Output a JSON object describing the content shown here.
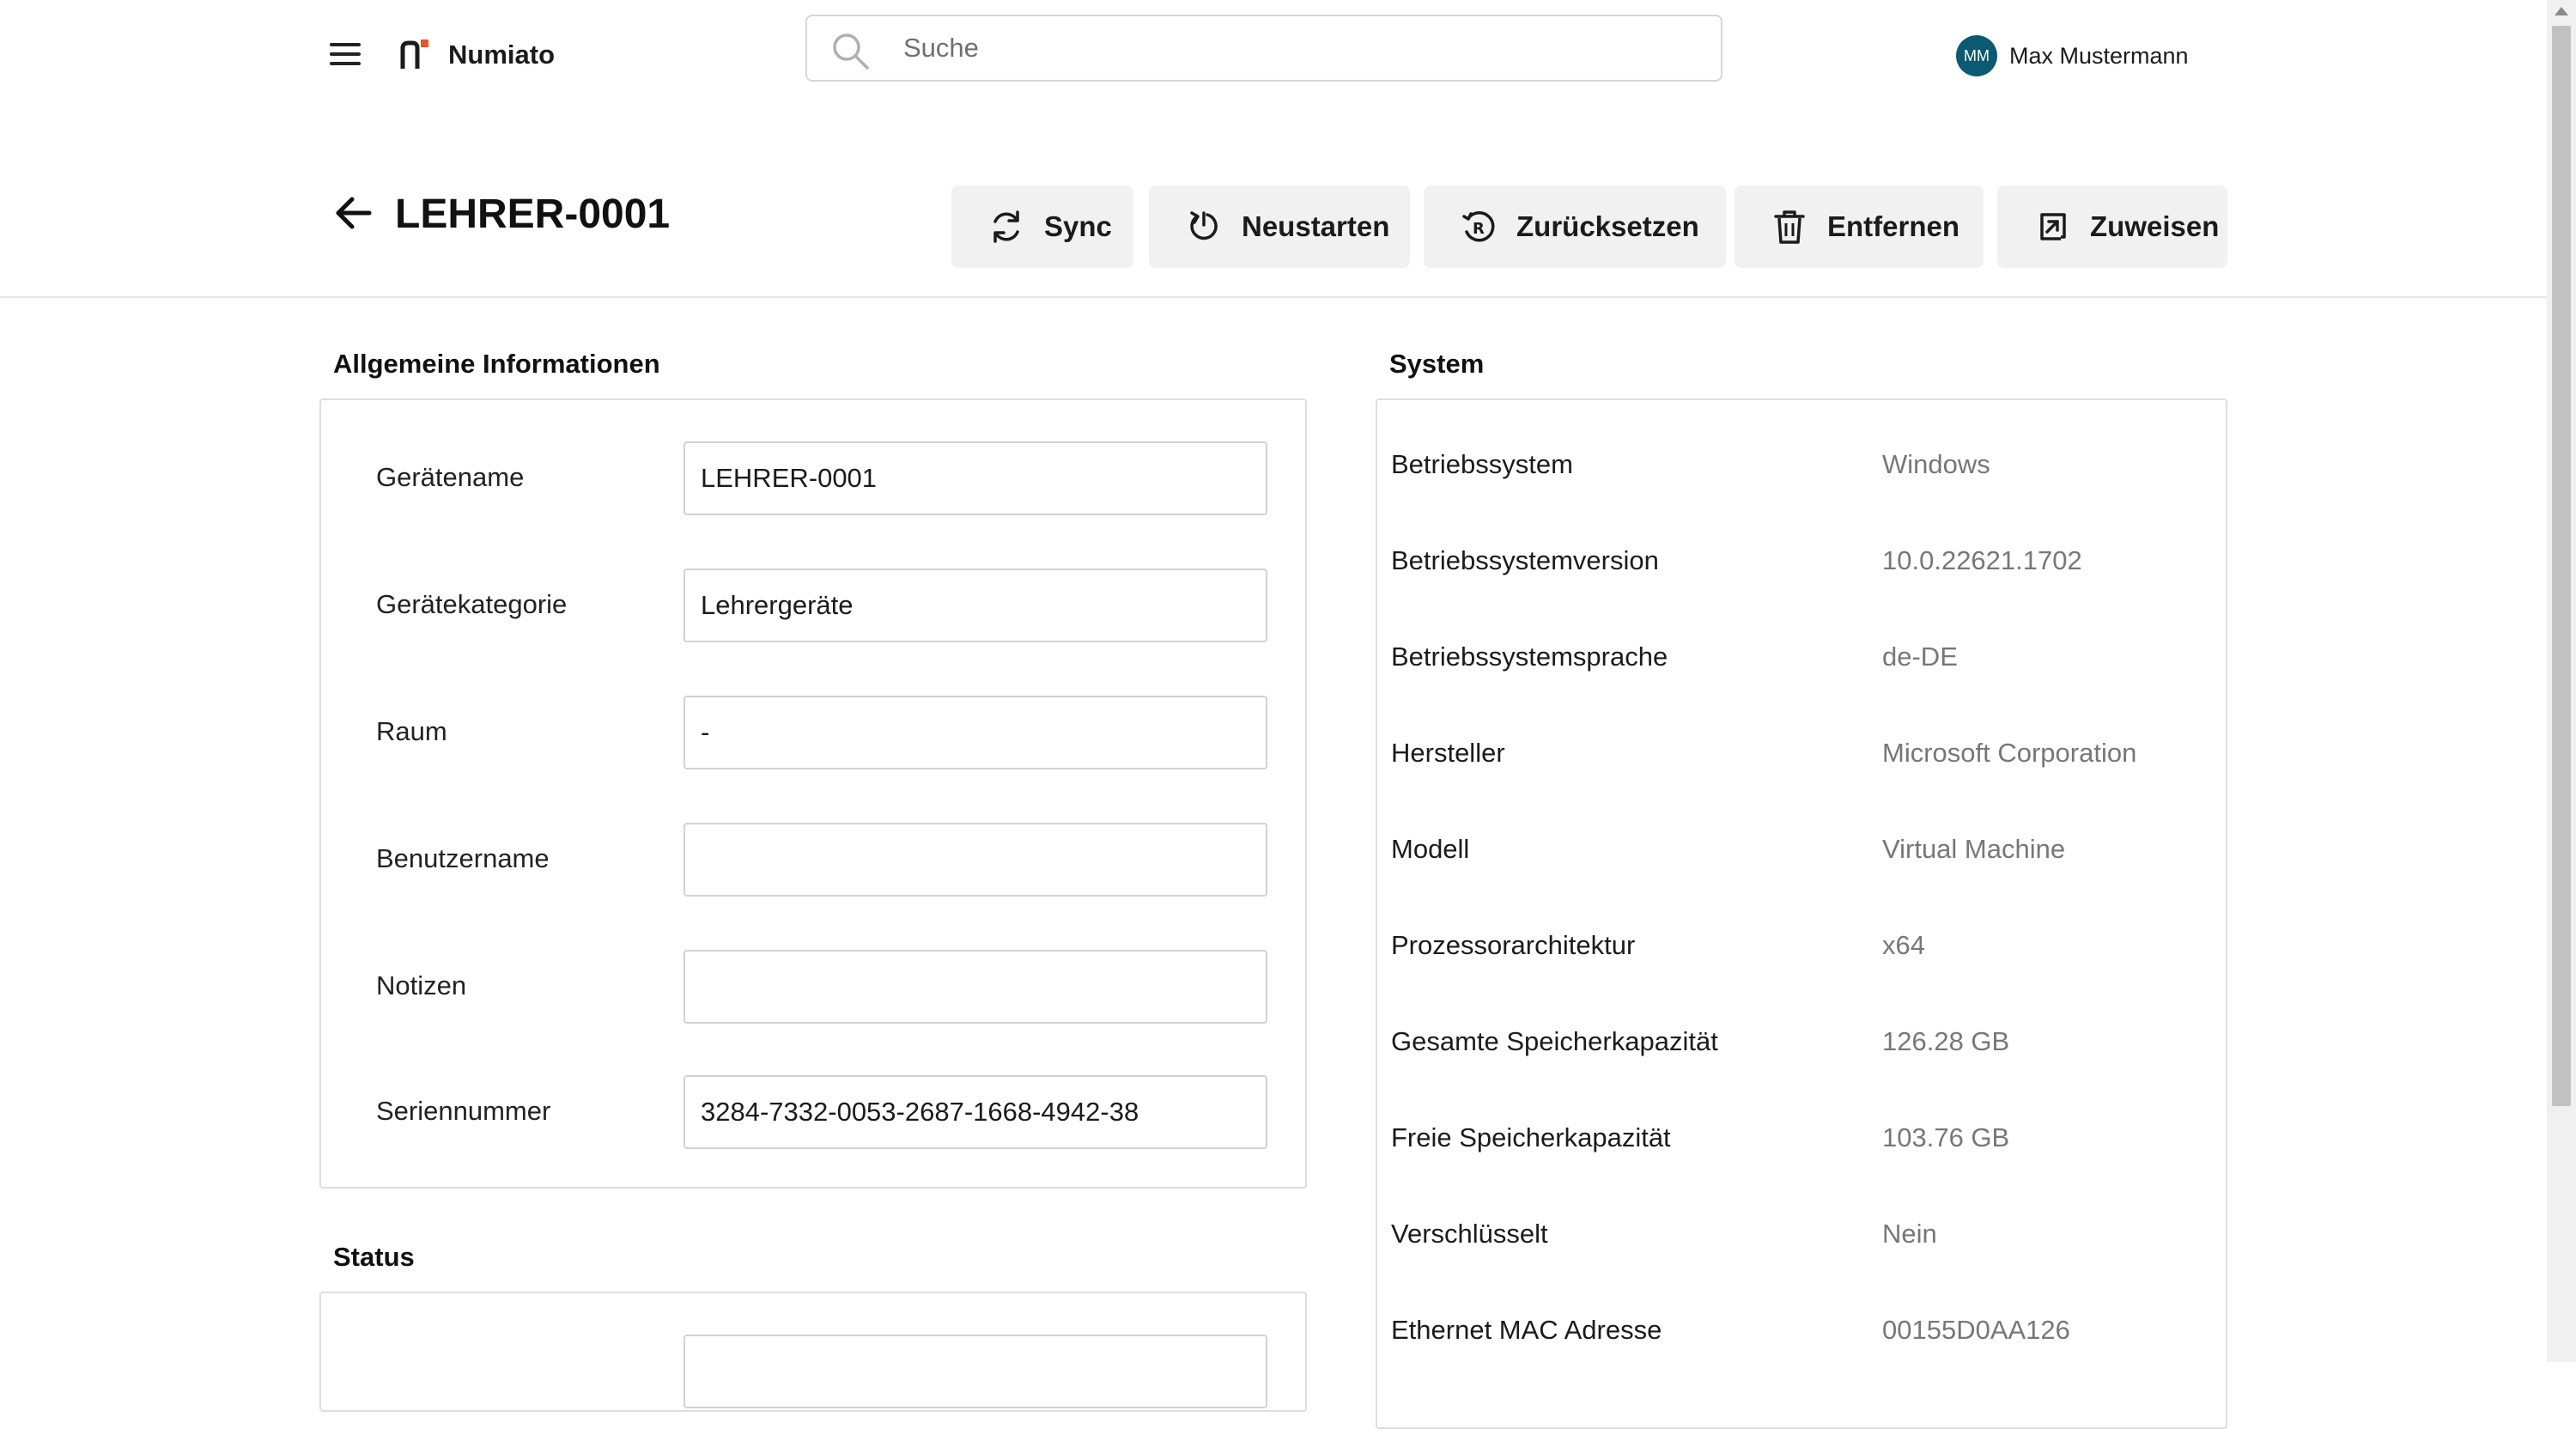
{
  "header": {
    "brand": "Numiato",
    "search_placeholder": "Suche",
    "user": {
      "initials": "MM",
      "name": "Max Mustermann"
    }
  },
  "page": {
    "title": "LEHRER-0001"
  },
  "actions": {
    "sync": "Sync",
    "restart": "Neustarten",
    "reset": "Zurücksetzen",
    "remove": "Entfernen",
    "assign": "Zuweisen"
  },
  "general": {
    "title": "Allgemeine Informationen",
    "fields": [
      {
        "label": "Gerätename",
        "value": "LEHRER-0001"
      },
      {
        "label": "Gerätekategorie",
        "value": "Lehrergeräte"
      },
      {
        "label": "Raum",
        "value": "-"
      },
      {
        "label": "Benutzername",
        "value": ""
      },
      {
        "label": "Notizen",
        "value": ""
      },
      {
        "label": "Seriennummer",
        "value": "3284-7332-0053-2687-1668-4942-38"
      }
    ]
  },
  "status": {
    "title": "Status"
  },
  "system": {
    "title": "System",
    "rows": [
      {
        "label": "Betriebssystem",
        "value": "Windows"
      },
      {
        "label": "Betriebssystemversion",
        "value": "10.0.22621.1702"
      },
      {
        "label": "Betriebssystemsprache",
        "value": "de-DE"
      },
      {
        "label": "Hersteller",
        "value": "Microsoft Corporation"
      },
      {
        "label": "Modell",
        "value": "Virtual Machine"
      },
      {
        "label": "Prozessorarchitektur",
        "value": "x64"
      },
      {
        "label": "Gesamte Speicherkapazität",
        "value": "126.28 GB"
      },
      {
        "label": "Freie Speicherkapazität",
        "value": "103.76 GB"
      },
      {
        "label": "Verschlüsselt",
        "value": "Nein"
      },
      {
        "label": "Ethernet MAC Adresse",
        "value": "00155D0AA126"
      }
    ]
  },
  "colors": {
    "avatar": "#0a5a72",
    "logo_accent": "#e8542a",
    "button_bg": "#f1f1f1",
    "muted_value": "#777777"
  }
}
